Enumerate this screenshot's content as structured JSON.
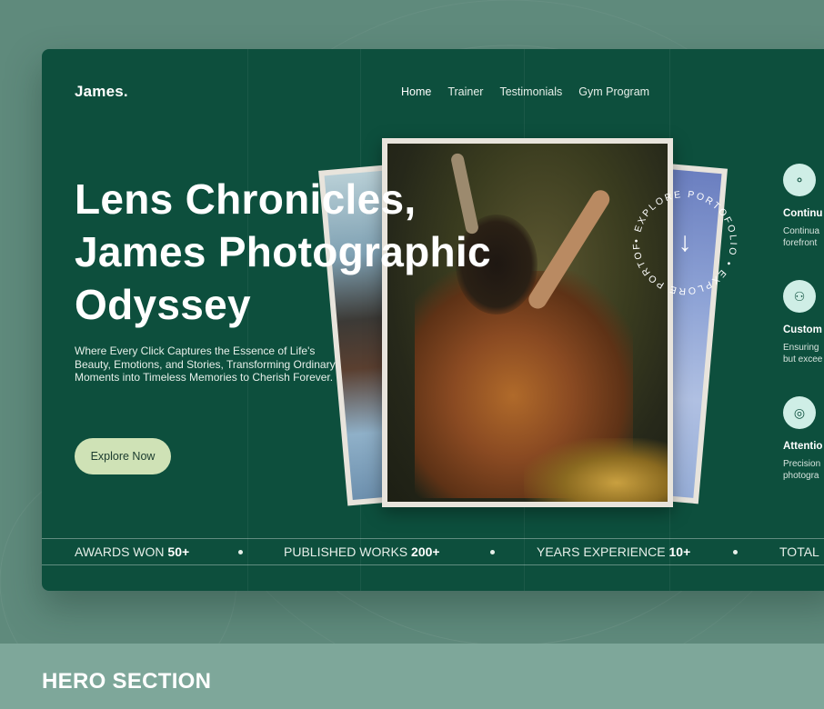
{
  "brand": {
    "logo": "James."
  },
  "nav": {
    "items": [
      "Home",
      "Trainer",
      "Testimonials",
      "Gym Program"
    ],
    "active": "Home"
  },
  "hero": {
    "title_lines": [
      "Lens Chronicles,",
      "James Photographic",
      "Odyssey"
    ],
    "subtitle_lines": [
      "Where Every Click Captures the Essence of Life's",
      "Beauty, Emotions, and Stories, Transforming Ordinary",
      "Moments into Timeless Memories to Cherish Forever."
    ],
    "cta_label": "Explore Now"
  },
  "badge": {
    "circle_text": "• EXPLORE PORTOFOLIO • EXPLORE PORTOFOLIO",
    "arrow": "↓"
  },
  "features": [
    {
      "icon": "circles-icon",
      "glyph": "⚬",
      "title": "Continu",
      "desc_lines": [
        "Continua",
        "forefront"
      ]
    },
    {
      "icon": "users-icon",
      "glyph": "⚇",
      "title": "Custom",
      "desc_lines": [
        "Ensuring",
        "but excee"
      ]
    },
    {
      "icon": "aperture-icon",
      "glyph": "◎",
      "title": "Attentio",
      "desc_lines": [
        "Precision",
        "photogra"
      ]
    }
  ],
  "stats": [
    {
      "label": "AWARDS WON",
      "value": "50+"
    },
    {
      "label": "PUBLISHED WORKS",
      "value": "200+"
    },
    {
      "label": "YEARS EXPERIENCE",
      "value": "10+"
    },
    {
      "label": "TOTAL",
      "value": ""
    }
  ],
  "footer": {
    "label": "HERO SECTION"
  },
  "colors": {
    "page_bg": "#5f8a7c",
    "card_bg": "#0d4f3d",
    "cta_bg": "#cfe2b6",
    "feature_icon_bg": "#cfeee6",
    "footer_bg": "#7ea79a"
  }
}
